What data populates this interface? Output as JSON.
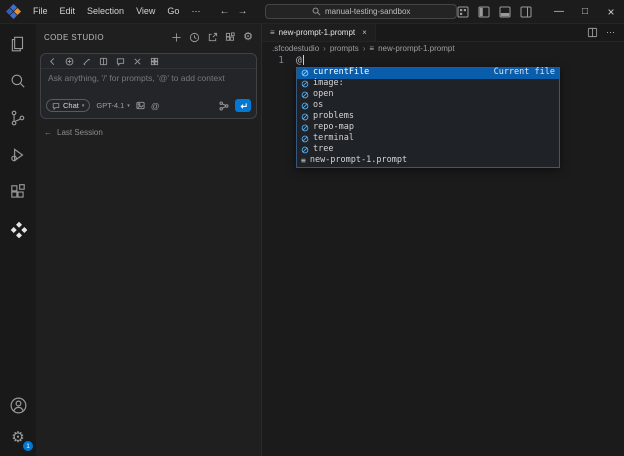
{
  "colors": {
    "accent": "#0078d4",
    "suggest_selected": "#0a5dab",
    "symbol_icon_blue": "#58aef0"
  },
  "glyphs": {
    "back": "←",
    "forward": "→",
    "ellipsis": "⋯",
    "minimize": "—",
    "maximize": "□",
    "close": "×",
    "gear": "⚙",
    "at": "@",
    "chevron_down": "▾",
    "crumb_sep": "›",
    "prompt_file": "≡",
    "tab_close": "×",
    "last_session_arrow": "←"
  },
  "titlebar": {
    "menus": [
      "File",
      "Edit",
      "Selection",
      "View",
      "Go"
    ],
    "search_value": "manual-testing-sandbox"
  },
  "activity_bar": {
    "settings_badge": "1"
  },
  "sidebar": {
    "title": "CODE STUDIO",
    "chat": {
      "placeholder": "Ask anything, '/' for prompts, '@' to add context",
      "mode_label": "Chat",
      "model_label": "GPT-4.1"
    },
    "last_session_label": "Last Session"
  },
  "editor": {
    "tab_label": "new-prompt-1.prompt",
    "breadcrumbs": [
      ".sfcodestudio",
      "prompts",
      "new-prompt-1.prompt"
    ],
    "line_number": "1",
    "line_text": "@"
  },
  "suggest": {
    "items": [
      {
        "label": "currentFile",
        "detail": "Current file"
      },
      {
        "label": "image:"
      },
      {
        "label": "open"
      },
      {
        "label": "os"
      },
      {
        "label": "problems"
      },
      {
        "label": "repo-map"
      },
      {
        "label": "terminal"
      },
      {
        "label": "tree"
      },
      {
        "label": "new-prompt-1.prompt"
      }
    ]
  }
}
